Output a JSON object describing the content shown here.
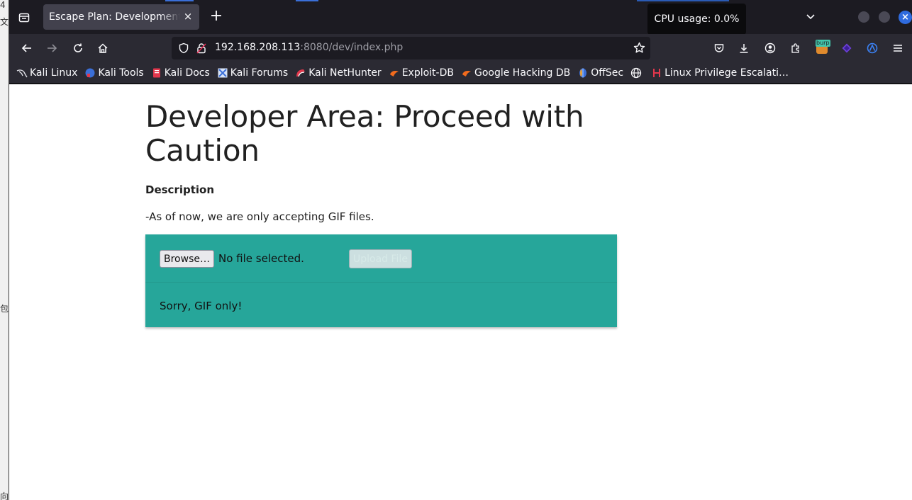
{
  "desktop_strip": {
    "glyphs": [
      "4",
      "文",
      "包",
      "向"
    ]
  },
  "tab": {
    "title": "Escape Plan: Development Ce",
    "close": "×"
  },
  "new_tab": "+",
  "tooltip": "CPU usage: 0.0%",
  "window_close": "×",
  "url": {
    "host": "192.168.208.113",
    "rest": ":8080/dev/index.php"
  },
  "bookmarks": [
    {
      "label": "Kali Linux",
      "icon": "kali-dragon-icon"
    },
    {
      "label": "Kali Tools",
      "icon": "kali-tools-icon"
    },
    {
      "label": "Kali Docs",
      "icon": "kali-docs-icon"
    },
    {
      "label": "Kali Forums",
      "icon": "kali-forums-icon"
    },
    {
      "label": "Kali NetHunter",
      "icon": "kali-nethunter-icon"
    },
    {
      "label": "Exploit-DB",
      "icon": "exploit-db-icon"
    },
    {
      "label": "Google Hacking DB",
      "icon": "ghdb-icon"
    },
    {
      "label": "OffSec",
      "icon": "offsec-icon"
    },
    {
      "label": "",
      "icon": "globe-icon"
    },
    {
      "label": "Linux Privilege Escalati…",
      "icon": "hacktricks-icon"
    }
  ],
  "extension_label": "burp",
  "page": {
    "heading": "Developer Area: Proceed with Caution",
    "description_heading": "Description",
    "description_text": "-As of now, we are only accepting GIF files.",
    "browse_label": "Browse…",
    "file_status": "No file selected.",
    "upload_label": "Upload File",
    "message": "Sorry, GIF only!"
  },
  "colors": {
    "panel": "#26a69a",
    "chrome": "#2b2a33",
    "tab_active": "#42414d"
  }
}
